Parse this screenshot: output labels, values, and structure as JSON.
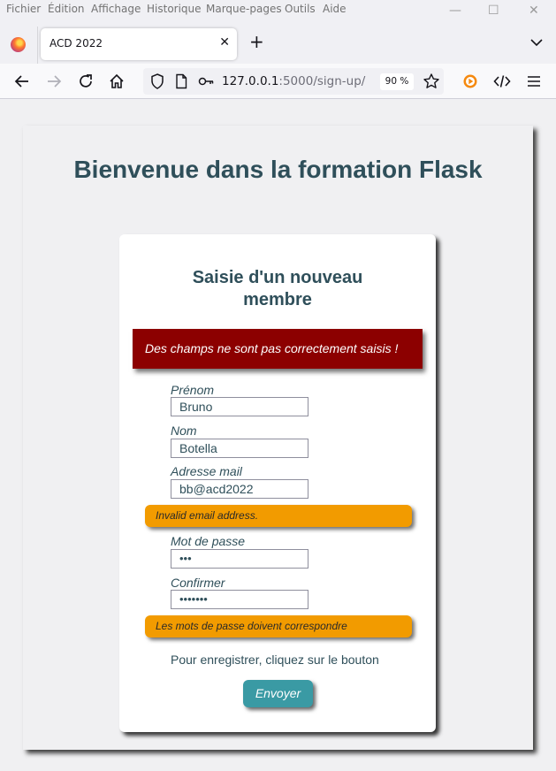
{
  "menu": {
    "items": [
      "Fichier",
      "Édition",
      "Affichage",
      "Historique",
      "Marque-pages",
      "Outils",
      "Aide"
    ]
  },
  "window_controls": {
    "minimize": "—",
    "maximize": "☐",
    "close": "✕"
  },
  "tab": {
    "title": "ACD 2022",
    "close": "✕",
    "new_tab": "+"
  },
  "urlbar": {
    "host": "127.0.0.1",
    "path": ":5000/sign-up/",
    "zoom": "90 %"
  },
  "page": {
    "title": "Bienvenue dans la formation Flask",
    "form": {
      "title_line1": "Saisie d'un nouveau",
      "title_line2": "membre",
      "flash_message": "Des champs ne sont pas correctement saisis !",
      "fields": {
        "first_name": {
          "label": "Prénom",
          "value": "Bruno"
        },
        "last_name": {
          "label": "Nom",
          "value": "Botella"
        },
        "email": {
          "label": "Adresse mail",
          "value": "bb@acd2022",
          "error": "Invalid email address."
        },
        "password": {
          "label": "Mot de passe",
          "value": "•••"
        },
        "confirm": {
          "label": "Confirmer",
          "value": "•••••••",
          "error": "Les mots de passe doivent correspondre"
        }
      },
      "hint": "Pour enregistrer, cliquez sur le bouton",
      "submit_label": "Envoyer"
    }
  },
  "colors": {
    "heading": "#2f4f5a",
    "flash_bg": "#8c0000",
    "error_bg": "#f29b00",
    "button_bg": "#3a9aa4"
  },
  "icons": [
    "firefox-logo-icon",
    "back-icon",
    "forward-icon",
    "reload-icon",
    "home-icon",
    "shield-icon",
    "page-icon",
    "key-icon",
    "bookmark-star-icon",
    "extension-icon",
    "devtools-icon",
    "menu-icon",
    "chevron-down-icon"
  ]
}
